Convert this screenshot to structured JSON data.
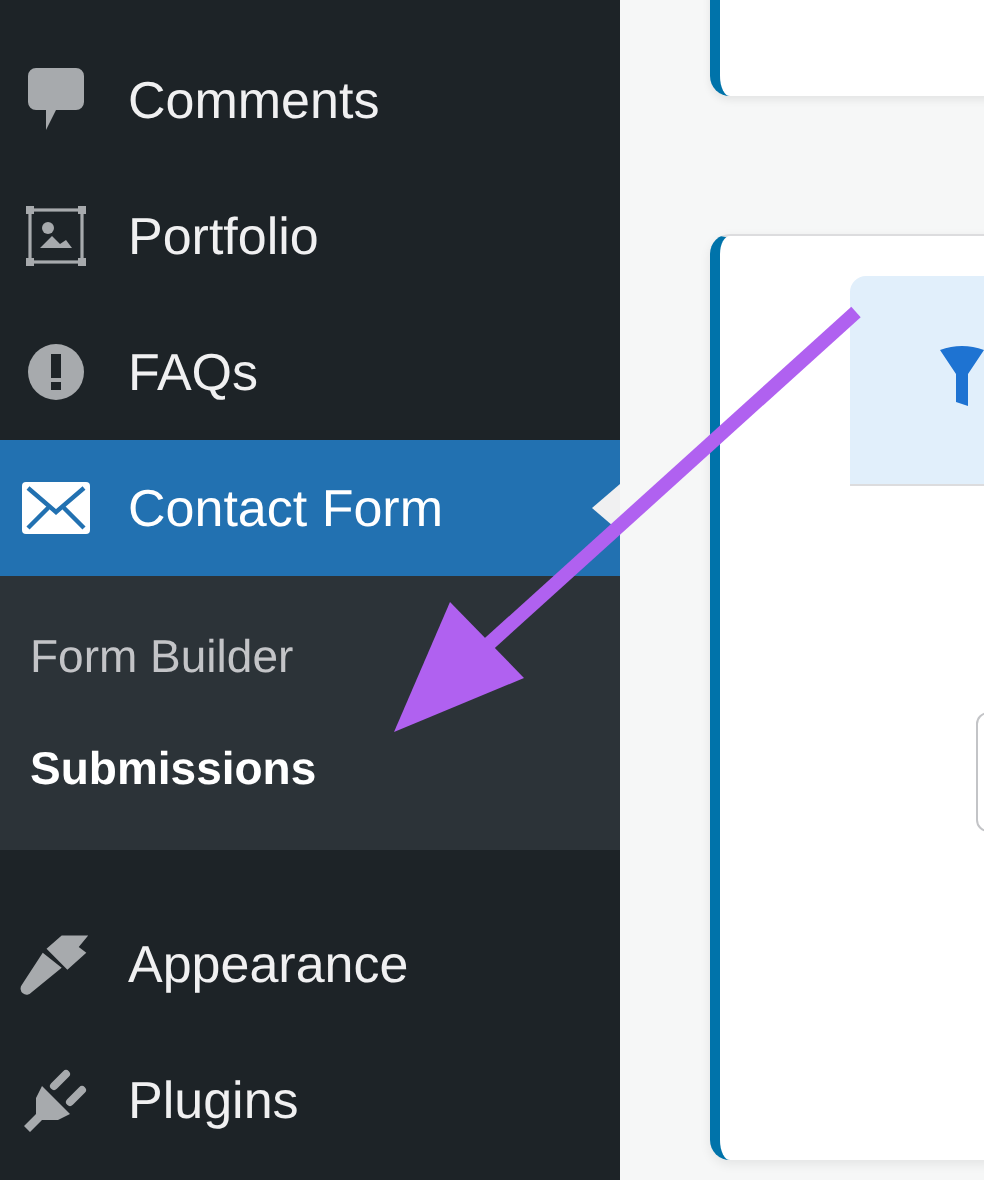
{
  "sidebar": {
    "items": [
      {
        "label": "Comments",
        "selected": false
      },
      {
        "label": "Portfolio",
        "selected": false
      },
      {
        "label": "FAQs",
        "selected": false
      },
      {
        "label": "Contact Form",
        "selected": true,
        "children": [
          {
            "label": "Form Builder",
            "selected": false
          },
          {
            "label": "Submissions",
            "selected": true
          }
        ]
      },
      {
        "label": "Appearance",
        "selected": false
      },
      {
        "label": "Plugins",
        "selected": false
      }
    ]
  }
}
